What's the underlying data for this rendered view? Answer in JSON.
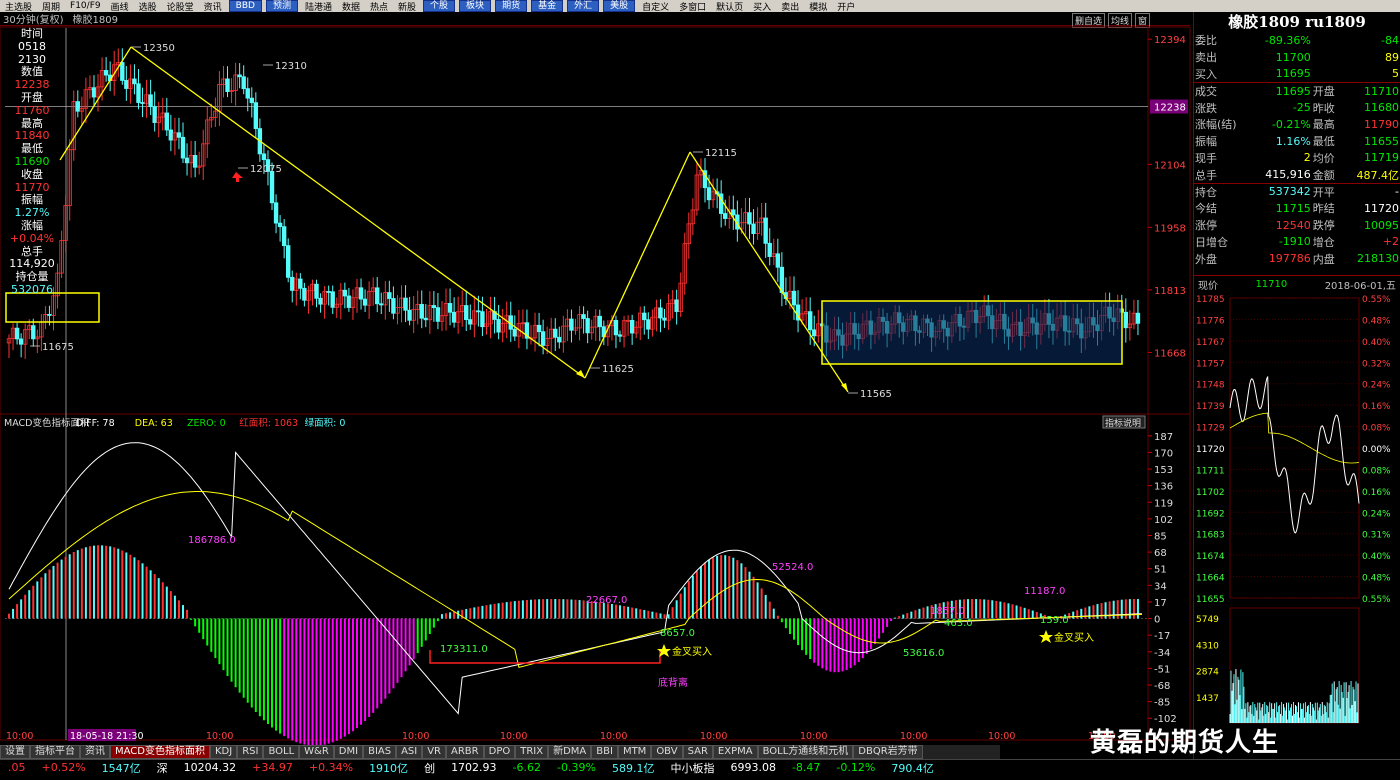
{
  "menu": [
    {
      "label": "主选股",
      "btn": false
    },
    {
      "label": "周期",
      "btn": false
    },
    {
      "label": "F10/F9",
      "btn": false
    },
    {
      "label": "画线",
      "btn": false
    },
    {
      "label": "选股",
      "btn": false
    },
    {
      "label": "论股堂",
      "btn": false
    },
    {
      "label": "资讯",
      "btn": false
    },
    {
      "label": "BBD",
      "btn": true
    },
    {
      "label": "预测",
      "btn": true
    },
    {
      "label": "陆港通",
      "btn": false
    },
    {
      "label": "数据",
      "btn": false
    },
    {
      "label": "热点",
      "btn": false
    },
    {
      "label": "新股",
      "btn": false
    },
    {
      "label": "个股",
      "btn": true
    },
    {
      "label": "板块",
      "btn": true
    },
    {
      "label": "期货",
      "btn": true
    },
    {
      "label": "基金",
      "btn": true
    },
    {
      "label": "外汇",
      "btn": true
    },
    {
      "label": "美股",
      "btn": true
    },
    {
      "label": "自定义",
      "btn": false
    },
    {
      "label": "多窗口",
      "btn": false
    },
    {
      "label": "默认页",
      "btn": false
    },
    {
      "label": "买入",
      "btn": false
    },
    {
      "label": "卖出",
      "btn": false
    },
    {
      "label": "模拟",
      "btn": false
    },
    {
      "label": "开户",
      "btn": false
    }
  ],
  "chart_header": {
    "period": "30分钟(复权)",
    "name": "橡胶1809",
    "ctrl": [
      "删自选",
      "均线",
      "窗"
    ]
  },
  "info": [
    {
      "t": "时间",
      "c": "wht"
    },
    {
      "t": "0518",
      "c": "wht"
    },
    {
      "t": "2130",
      "c": "wht"
    },
    {
      "t": "数值",
      "c": "wht"
    },
    {
      "t": "12238",
      "c": "red"
    },
    {
      "t": "开盘",
      "c": "wht"
    },
    {
      "t": "11760",
      "c": "red"
    },
    {
      "t": "最高",
      "c": "wht"
    },
    {
      "t": "11840",
      "c": "red"
    },
    {
      "t": "最低",
      "c": "wht"
    },
    {
      "t": "11690",
      "c": "grn"
    },
    {
      "t": "收盘",
      "c": "wht"
    },
    {
      "t": "11770",
      "c": "red"
    },
    {
      "t": "振幅",
      "c": "wht"
    },
    {
      "t": "1.27%",
      "c": "cyn"
    },
    {
      "t": "涨幅",
      "c": "wht"
    },
    {
      "t": "+0.04%",
      "c": "red"
    },
    {
      "t": "总手",
      "c": "wht"
    },
    {
      "t": "114,920",
      "c": "wht"
    },
    {
      "t": "持仓量",
      "c": "wht"
    },
    {
      "t": "532076",
      "c": "cyn"
    }
  ],
  "price_axis": [
    "12394",
    "12238",
    "12104",
    "11958",
    "11813",
    "11668"
  ],
  "price_marks": [
    "12350",
    "12310",
    "12075",
    "12115",
    "11675",
    "11625",
    "11565"
  ],
  "macd_header": {
    "name": "MACD变色指标面积",
    "diff": "DIFF: 78",
    "dea": "DEA: 63",
    "zero": "ZERO: 0",
    "red_area": "红面积: 1063",
    "green_area": "绿面积: 0",
    "btn": "指标说明"
  },
  "macd_axis": [
    "187",
    "170",
    "153",
    "136",
    "119",
    "102",
    "85",
    "68",
    "51",
    "34",
    "17",
    "0",
    "-17",
    "-34",
    "-51",
    "-68",
    "-85",
    "-102"
  ],
  "macd_labels": [
    "186786.0",
    "22667.0",
    "52524.0",
    "11187.0",
    "1857.0",
    "173311.0",
    "8657.0",
    "463.0",
    "159.0",
    "53616.0"
  ],
  "signals": [
    "金叉买入",
    "金叉买入",
    "底背离"
  ],
  "time_axis": [
    "10:00",
    "18-05-18 21:30",
    "10:00",
    "10:00",
    "10:00",
    "10:00",
    "10:00",
    "10:00",
    "10:00",
    "10:00",
    "10:00",
    "10:00"
  ],
  "right": {
    "title": "橡胶1809 ru1809",
    "rows": [
      [
        {
          "t": "委比",
          "c": "l"
        },
        {
          "t": "-89.36%",
          "c": "grn"
        },
        {
          "t": "",
          "c": "l"
        },
        {
          "t": "-84",
          "c": "grn"
        }
      ],
      [
        {
          "t": "卖出",
          "c": "l"
        },
        {
          "t": "11700",
          "c": "grn"
        },
        {
          "t": "",
          "c": "l"
        },
        {
          "t": "89",
          "c": "yel"
        }
      ],
      [
        {
          "t": "买入",
          "c": "l"
        },
        {
          "t": "11695",
          "c": "grn"
        },
        {
          "t": "",
          "c": "l"
        },
        {
          "t": "5",
          "c": "yel"
        }
      ],
      [
        {
          "t": "成交",
          "c": "l"
        },
        {
          "t": "11695",
          "c": "grn"
        },
        {
          "t": "开盘",
          "c": "l"
        },
        {
          "t": "11710",
          "c": "grn"
        }
      ],
      [
        {
          "t": "涨跌",
          "c": "l"
        },
        {
          "t": "-25",
          "c": "grn"
        },
        {
          "t": "昨收",
          "c": "l"
        },
        {
          "t": "11680",
          "c": "grn"
        }
      ],
      [
        {
          "t": "涨幅(结)",
          "c": "l"
        },
        {
          "t": "-0.21%",
          "c": "grn"
        },
        {
          "t": "最高",
          "c": "l"
        },
        {
          "t": "11790",
          "c": "red"
        }
      ],
      [
        {
          "t": "振幅",
          "c": "l"
        },
        {
          "t": "1.16%",
          "c": "cyn"
        },
        {
          "t": "最低",
          "c": "l"
        },
        {
          "t": "11655",
          "c": "grn"
        }
      ],
      [
        {
          "t": "现手",
          "c": "l"
        },
        {
          "t": "2",
          "c": "yel"
        },
        {
          "t": "均价",
          "c": "l"
        },
        {
          "t": "11719",
          "c": "grn"
        }
      ],
      [
        {
          "t": "总手",
          "c": "l"
        },
        {
          "t": "415,916",
          "c": "wht"
        },
        {
          "t": "金额",
          "c": "l"
        },
        {
          "t": "487.4亿",
          "c": "yel"
        }
      ],
      [
        {
          "t": "持仓",
          "c": "l"
        },
        {
          "t": "537342",
          "c": "cyn"
        },
        {
          "t": "开平",
          "c": "l"
        },
        {
          "t": "-",
          "c": "wht"
        }
      ],
      [
        {
          "t": "今结",
          "c": "l"
        },
        {
          "t": "11715",
          "c": "grn"
        },
        {
          "t": "昨结",
          "c": "l"
        },
        {
          "t": "11720",
          "c": "wht"
        }
      ],
      [
        {
          "t": "涨停",
          "c": "l"
        },
        {
          "t": "12540",
          "c": "red"
        },
        {
          "t": "跌停",
          "c": "l"
        },
        {
          "t": "10095",
          "c": "grn"
        }
      ],
      [
        {
          "t": "日增仓",
          "c": "l"
        },
        {
          "t": "-1910",
          "c": "grn"
        },
        {
          "t": "增仓",
          "c": "l"
        },
        {
          "t": "+2",
          "c": "red"
        }
      ],
      [
        {
          "t": "外盘",
          "c": "l"
        },
        {
          "t": "197786",
          "c": "red"
        },
        {
          "t": "内盘",
          "c": "l"
        },
        {
          "t": "218130",
          "c": "grn"
        }
      ]
    ],
    "now": {
      "label": "现价",
      "price": "11710",
      "date": "2018-06-01,五"
    },
    "mini_left": [
      "11785",
      "11776",
      "11767",
      "11757",
      "11748",
      "11739",
      "11729",
      "11720",
      "11711",
      "11702",
      "11692",
      "11683",
      "11674",
      "11664",
      "11655"
    ],
    "mini_right": [
      "0.55%",
      "0.48%",
      "0.40%",
      "0.32%",
      "0.24%",
      "0.16%",
      "0.08%",
      "0.00%",
      "0.08%",
      "0.16%",
      "0.24%",
      "0.31%",
      "0.40%",
      "0.48%",
      "0.55%"
    ],
    "vol_axis": [
      "5749",
      "4310",
      "2874",
      "1437"
    ]
  },
  "tabs": [
    "设置",
    "指标平台",
    "资讯",
    "MACD变色指标面积",
    "KDJ",
    "RSI",
    "BOLL",
    "W&R",
    "DMI",
    "BIAS",
    "ASI",
    "VR",
    "ARBR",
    "DPO",
    "TRIX",
    "新DMA",
    "BBI",
    "MTM",
    "OBV",
    "SAR",
    "EXPMA",
    "BOLL方通线和元机",
    "DBQR岩芳带"
  ],
  "status": [
    {
      "t": ".05",
      "c": "red"
    },
    {
      "t": "+0.52%",
      "c": "red"
    },
    {
      "t": "1547亿",
      "c": "cyn"
    },
    {
      "t": "深",
      "c": "wht"
    },
    {
      "t": "10204.32",
      "c": "wht"
    },
    {
      "t": "+34.97",
      "c": "red"
    },
    {
      "t": "+0.34%",
      "c": "red"
    },
    {
      "t": "1910亿",
      "c": "cyn"
    },
    {
      "t": "创",
      "c": "wht"
    },
    {
      "t": "1702.93",
      "c": "wht"
    },
    {
      "t": "-6.62",
      "c": "grn"
    },
    {
      "t": "-0.39%",
      "c": "grn"
    },
    {
      "t": "589.1亿",
      "c": "cyn"
    },
    {
      "t": "中小板指",
      "c": "wht"
    },
    {
      "t": "6993.08",
      "c": "wht"
    },
    {
      "t": "-8.47",
      "c": "grn"
    },
    {
      "t": "-0.12%",
      "c": "grn"
    },
    {
      "t": "790.4亿",
      "c": "cyn"
    }
  ],
  "watermark": "黄磊的期货人生",
  "colors": {
    "up": "#ff3232",
    "down": "#54fcfc",
    "trend": "#ffff00",
    "diff": "#ffffff",
    "dea": "#ffff00",
    "macd_pos": "#ff3232",
    "macd_neg_g": "#00ff00",
    "macd_neg_m": "#ff00ff",
    "macd_pos_c": "#54fcfc",
    "box_fill": "#0a2a5a"
  }
}
